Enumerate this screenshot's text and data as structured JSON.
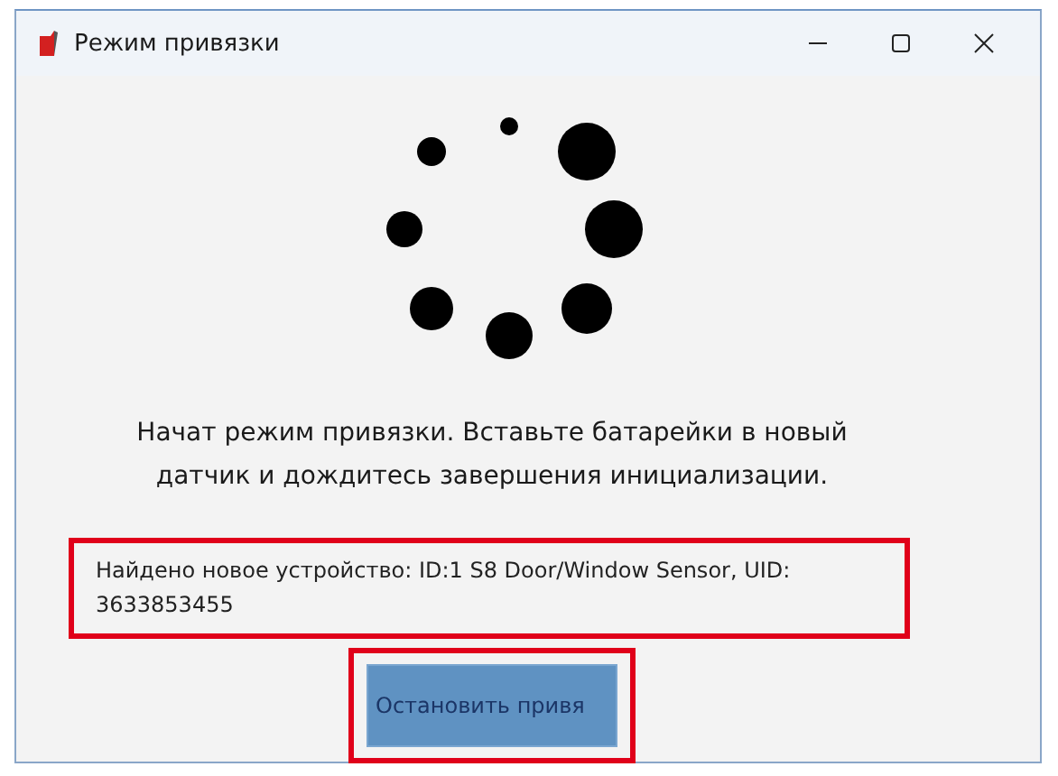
{
  "window": {
    "title": "Режим привязки"
  },
  "message": "Начат режим привязки. Вставьте батарейки в новый датчик и дождитесь завершения инициализации.",
  "found_device": {
    "text": "Найдено новое устройство: ID:1 S8 Door/Window Sensor, UID: 3633853455",
    "highlighted": true
  },
  "stop_button": {
    "label": "Остановить привя",
    "highlighted": true
  }
}
